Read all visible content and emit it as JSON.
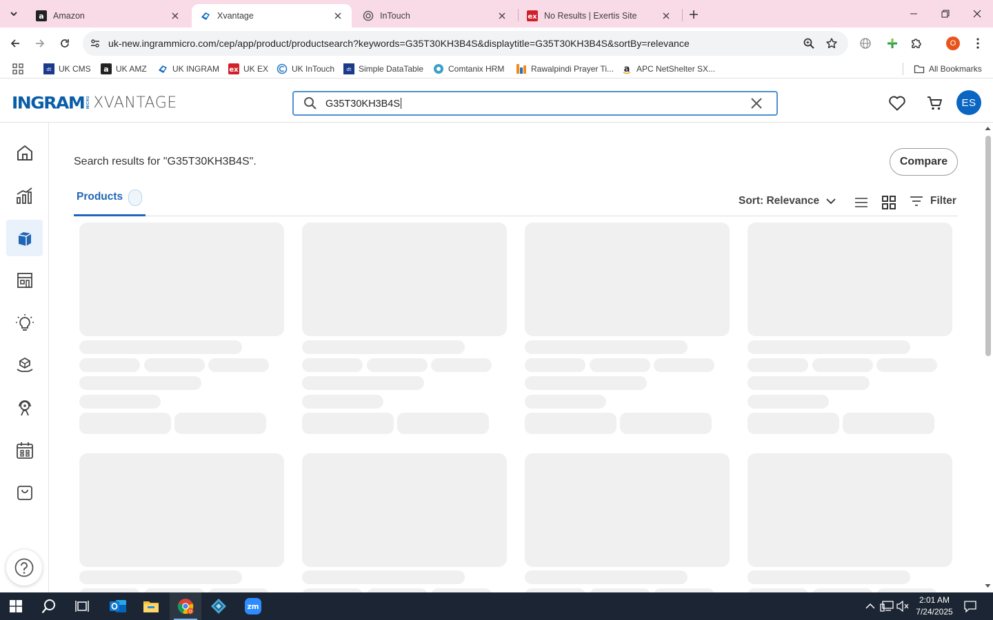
{
  "browser": {
    "tabs": [
      {
        "title": "Amazon",
        "active": false
      },
      {
        "title": "Xvantage",
        "active": true
      },
      {
        "title": "InTouch",
        "active": false
      },
      {
        "title": "No Results | Exertis Site",
        "active": false
      }
    ],
    "url": "uk-new.ingrammicro.com/cep/app/product/productsearch?keywords=G35T30KH3B4S&displaytitle=G35T30KH3B4S&sortBy=relevance",
    "profile_initial": "O",
    "bookmarks": [
      {
        "label": "UK CMS",
        "icon": "datatable-icon"
      },
      {
        "label": "UK AMZ",
        "icon": "amazon-icon"
      },
      {
        "label": "UK INGRAM",
        "icon": "ingram-icon"
      },
      {
        "label": "UK EX",
        "icon": "exertis-icon"
      },
      {
        "label": "UK InTouch",
        "icon": "intouch-icon"
      },
      {
        "label": "Simple DataTable",
        "icon": "datatable-icon"
      },
      {
        "label": "Comtanix HRM",
        "icon": "comtanix-icon"
      },
      {
        "label": "Rawalpindi Prayer Ti...",
        "icon": "prayer-icon"
      },
      {
        "label": "APC NetShelter SX...",
        "icon": "amazon-icon"
      }
    ],
    "all_bookmarks_label": "All Bookmarks"
  },
  "app": {
    "search_value": "G35T30KH3B4S",
    "avatar_initials": "ES",
    "results_title": "Search results for \"G35T30KH3B4S\".",
    "compare_label": "Compare",
    "tab_products_label": "Products",
    "sort_label": "Sort: Relevance",
    "filter_label": "Filter",
    "rail_items": [
      {
        "name": "home-icon",
        "active": false
      },
      {
        "name": "analytics-icon",
        "active": false
      },
      {
        "name": "products-box-icon",
        "active": true
      },
      {
        "name": "store-icon",
        "active": false
      },
      {
        "name": "lightbulb-icon",
        "active": false
      },
      {
        "name": "services-icon",
        "active": false
      },
      {
        "name": "support-agent-icon",
        "active": false
      },
      {
        "name": "calendar-icon",
        "active": false
      },
      {
        "name": "shopping-bag-icon",
        "active": false
      }
    ],
    "loading_card_count": 8
  },
  "taskbar": {
    "time": "2:01 AM",
    "date": "7/24/2025",
    "apps": [
      "windows-start-icon",
      "search-icon",
      "task-view-icon",
      "outlook-icon",
      "file-explorer-icon",
      "chrome-icon",
      "app-diamond-icon",
      "zoom-icon"
    ]
  },
  "colors": {
    "brand_blue": "#0a5ea8",
    "accent_blue": "#1f66b5",
    "tabbar_pink": "#f9dbe7",
    "skeleton_gray": "#f0f0f0"
  }
}
